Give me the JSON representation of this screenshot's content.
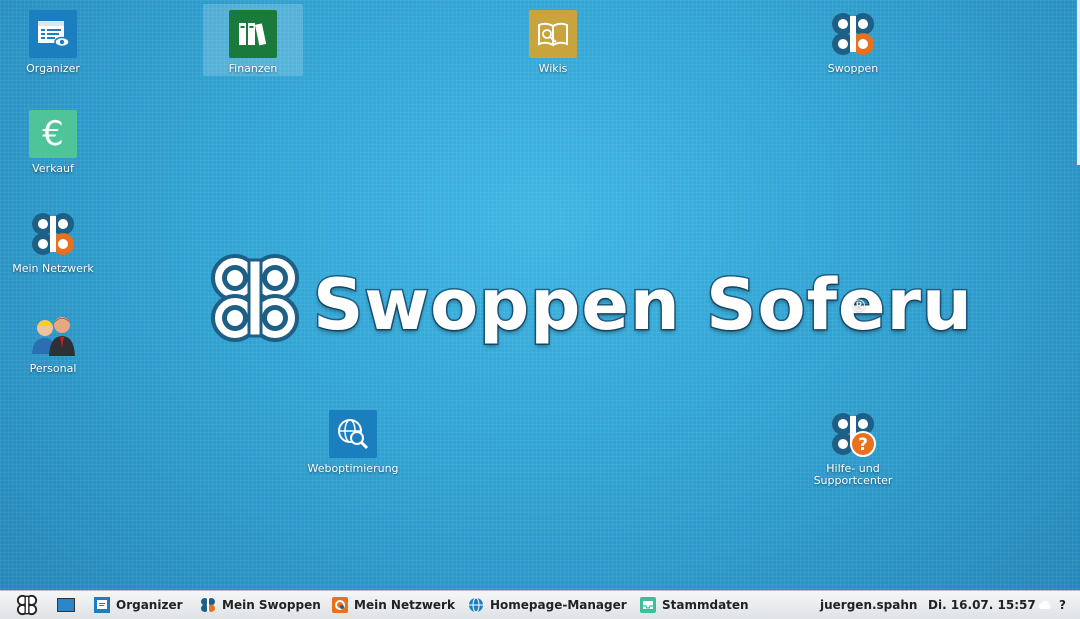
{
  "desktop": {
    "icons": [
      {
        "label": "Organizer"
      },
      {
        "label": "Finanzen"
      },
      {
        "label": "Wikis"
      },
      {
        "label": "Swoppen"
      },
      {
        "label": "Verkauf"
      },
      {
        "label": "Mein Netzwerk"
      },
      {
        "label": "Personal"
      },
      {
        "label": "Weboptimierung"
      },
      {
        "label": "Hilfe- und\nSupportcenter"
      }
    ]
  },
  "logo": {
    "text": "Swoppen Soferu",
    "registered": "®"
  },
  "taskbar": {
    "items": [
      {
        "label": "Organizer"
      },
      {
        "label": "Mein Swoppen"
      },
      {
        "label": "Mein Netzwerk"
      },
      {
        "label": "Homepage-Manager"
      },
      {
        "label": "Stammdaten"
      }
    ],
    "user": "juergen.spahn",
    "datetime": "Di. 16.07. 15:57",
    "help": "?"
  },
  "colors": {
    "desktop_bg": "#30a3d3",
    "organizer_tile": "#1b7fbf",
    "finanzen_tile": "#1a7a3c",
    "wikis_tile": "#c9a33c",
    "verkauf_tile": "#4fc49b",
    "weboptimierung_tile": "#1b7fbf",
    "swoppen_dark": "#1e5f86",
    "swoppen_orange": "#e8701e"
  },
  "icons": {
    "organizer": "organizer-form-icon",
    "finanzen": "binders-icon",
    "wikis": "open-book-icon",
    "swoppen": "swoppen-logo-icon",
    "verkauf": "euro-icon",
    "mein_netzwerk": "swoppen-logo-icon",
    "personal": "people-icon",
    "weboptimierung": "globe-magnifier-icon",
    "hilfe": "help-question-icon"
  }
}
